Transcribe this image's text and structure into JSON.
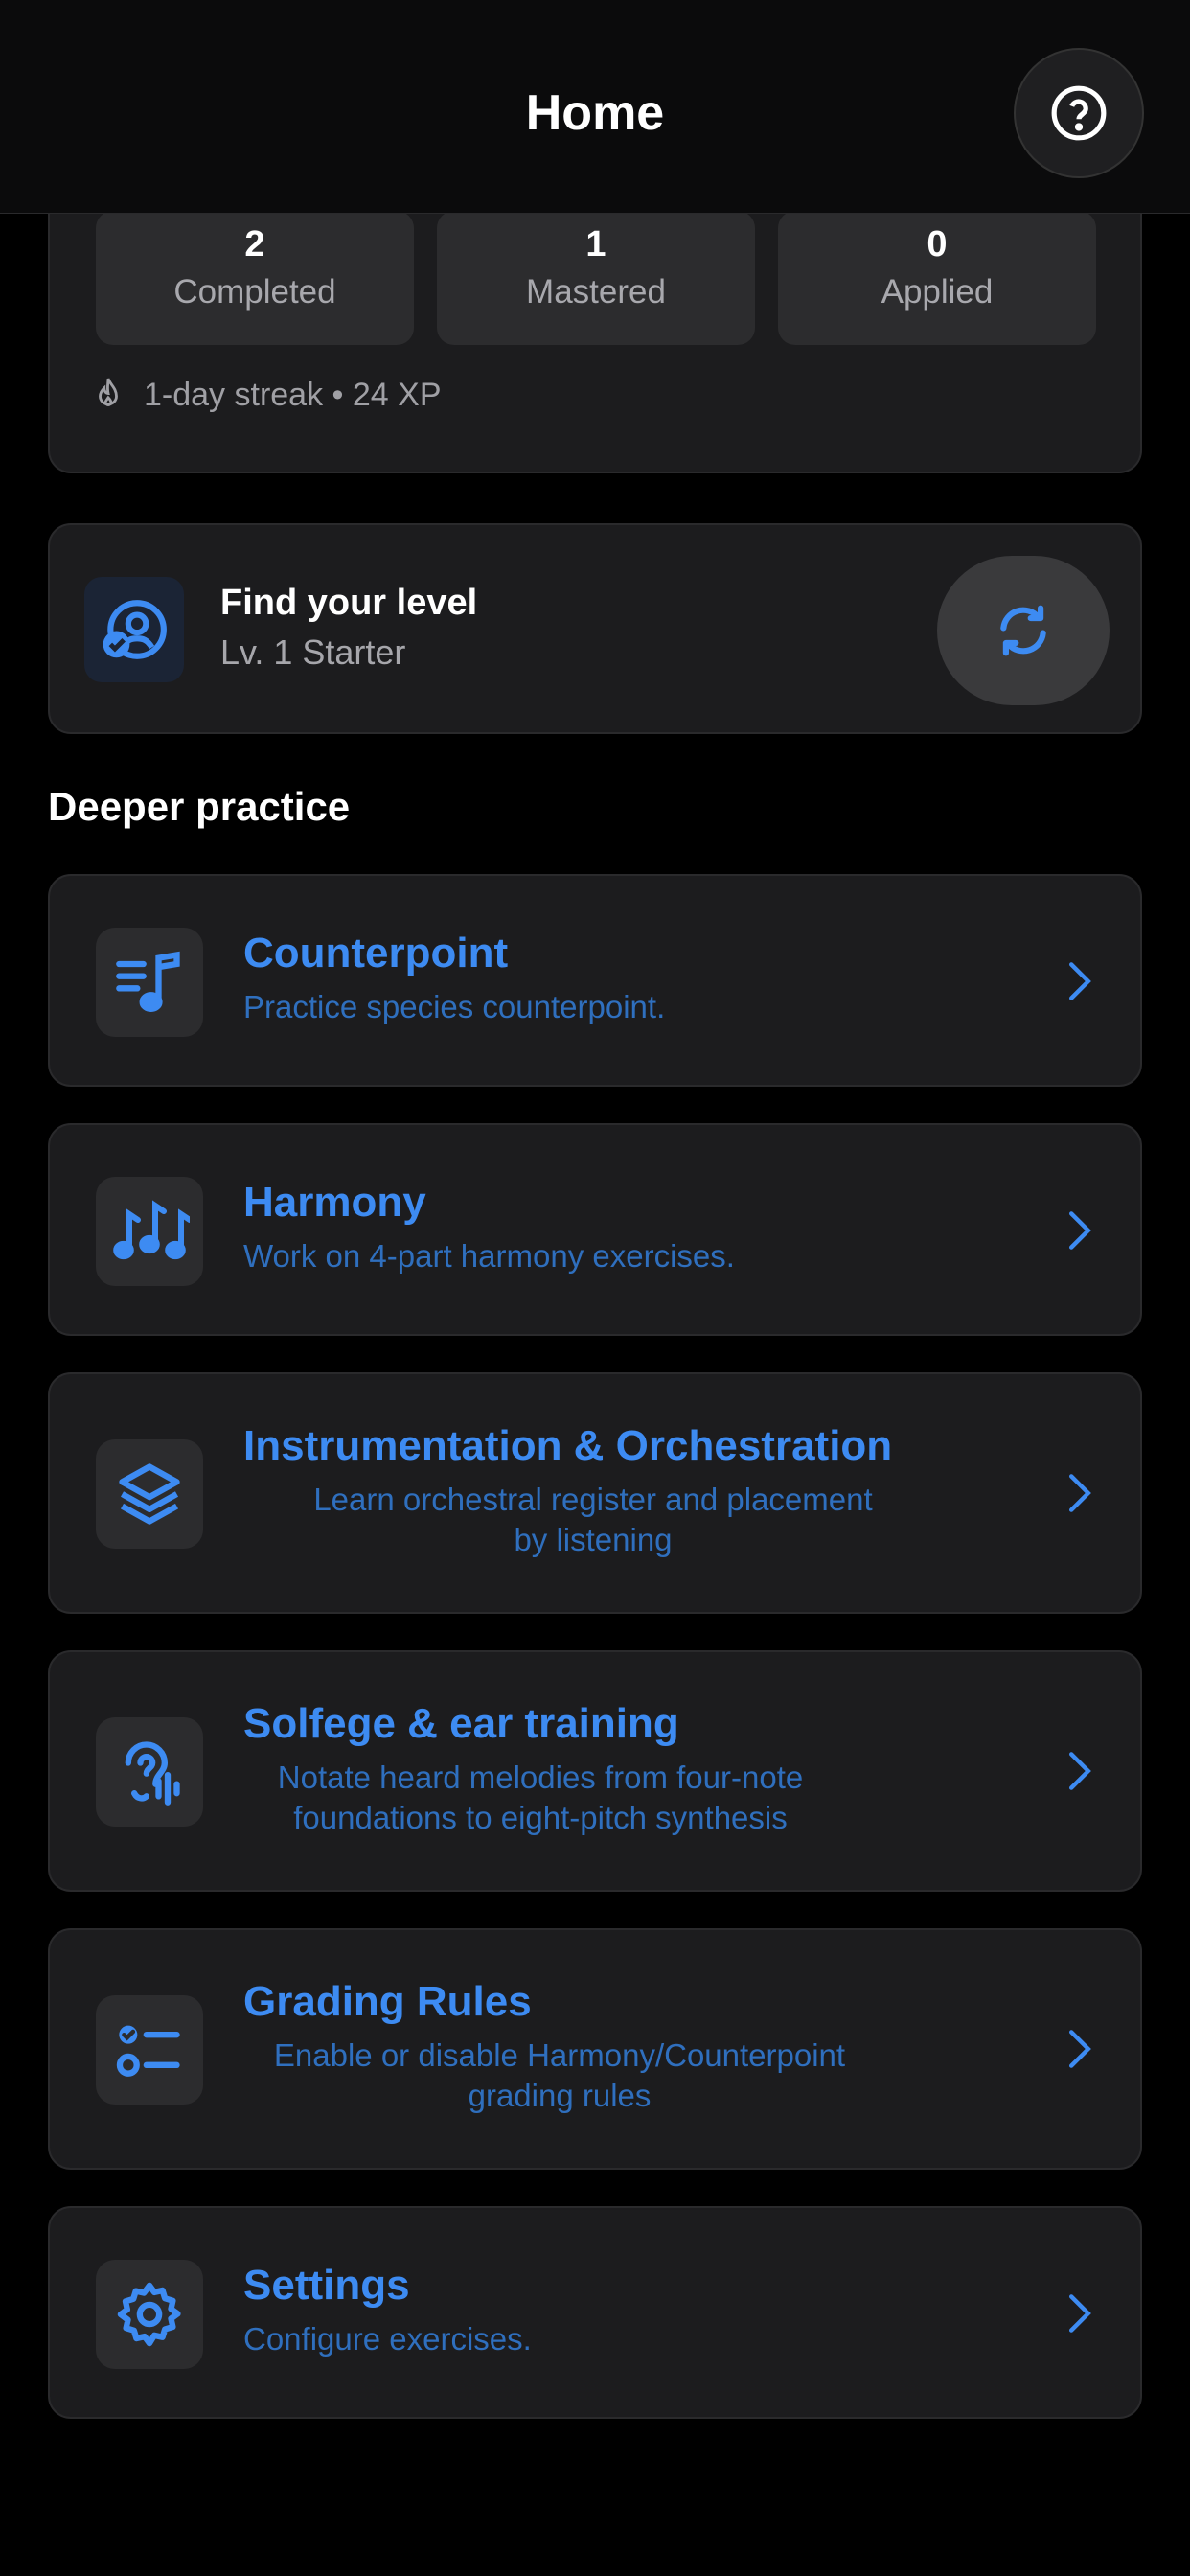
{
  "header": {
    "title": "Home",
    "help_icon": "question-circle-icon"
  },
  "stats": [
    {
      "value": "2",
      "label": "Completed"
    },
    {
      "value": "1",
      "label": "Mastered"
    },
    {
      "value": "0",
      "label": "Applied"
    }
  ],
  "streak": {
    "text": "1-day streak • 24 XP",
    "icon": "flame-icon"
  },
  "level": {
    "title": "Find your level",
    "subtitle": "Lv. 1 Starter",
    "icon": "user-check-icon",
    "button_icon": "refresh-icon"
  },
  "section": {
    "title": "Deeper practice"
  },
  "items": [
    {
      "title": "Counterpoint",
      "desc": "Practice species counterpoint.",
      "icon": "music-list-icon"
    },
    {
      "title": "Harmony",
      "desc": "Work on 4-part harmony exercises.",
      "icon": "notes-icon"
    },
    {
      "title": "Instrumentation & Orchestration",
      "desc_line1": "Learn orchestral register and placement",
      "desc_line2": "by listening",
      "icon": "layers-icon"
    },
    {
      "title": "Solfege & ear training",
      "desc_line1": "Notate heard melodies from four-note",
      "desc_line2": "foundations to eight-pitch synthesis",
      "icon": "ear-icon"
    },
    {
      "title": "Grading Rules",
      "desc_line1": "Enable or disable Harmony/Counterpoint",
      "desc_line2": "grading rules",
      "icon": "checklist-icon"
    },
    {
      "title": "Settings",
      "desc": "Configure exercises.",
      "icon": "gear-icon"
    }
  ],
  "colors": {
    "accent": "#3d8bf2",
    "card": "#1c1c1e",
    "background": "#000000"
  }
}
